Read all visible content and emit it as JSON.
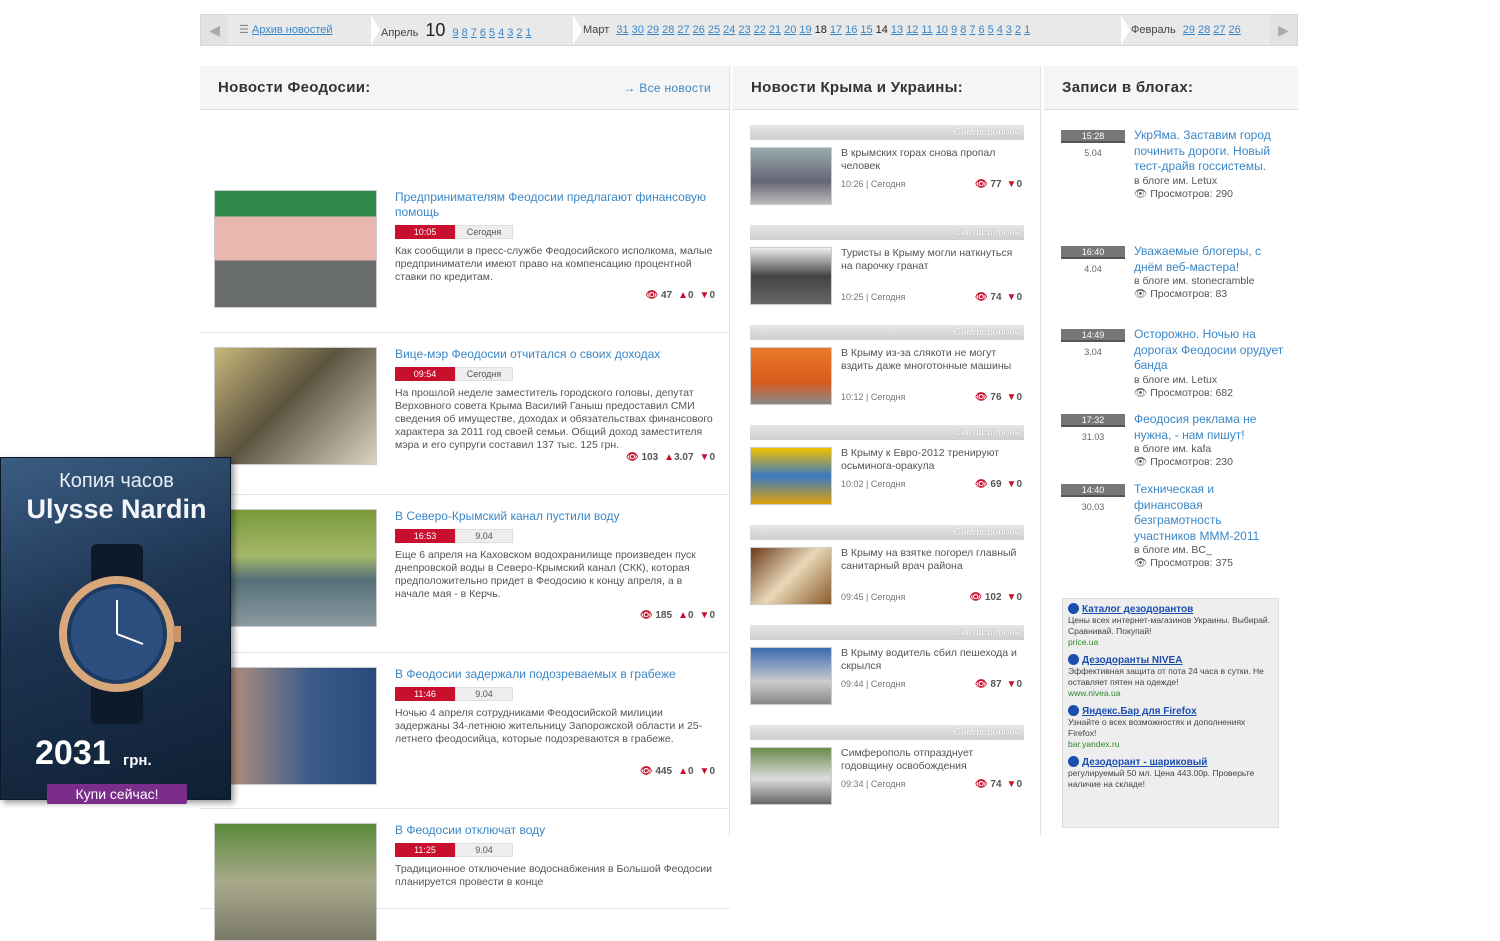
{
  "archive": {
    "link": "Архив новостей",
    "april": {
      "label": "Апрель",
      "current": "10",
      "days": [
        "9",
        "8",
        "7",
        "6",
        "5",
        "4",
        "3",
        "2",
        "1"
      ]
    },
    "march": {
      "label": "Март",
      "days": [
        "31",
        "30",
        "29",
        "28",
        "27",
        "26",
        "25",
        "24",
        "23",
        "22",
        "21",
        "20",
        "19"
      ],
      "bold1": "18",
      "days2": [
        "17",
        "16",
        "15"
      ],
      "bold2": "14",
      "days3": [
        "13",
        "12",
        "11",
        "10",
        "9",
        "8",
        "7",
        "6",
        "5",
        "4",
        "3",
        "2",
        "1"
      ]
    },
    "february": {
      "label": "Февраль",
      "days": [
        "29",
        "28",
        "27",
        "26"
      ]
    }
  },
  "col1": {
    "title": "Новости Феодосии:",
    "all_link": "→ Все новости",
    "items": [
      {
        "title": "Предпринимателям Феодосии предлагают финансовую помощь",
        "time": "10:05",
        "date": "Сегодня",
        "text": "Как сообщили в пресс-службе Феодосийского исполкома, малые предприниматели имеют право на компенсацию процентной ставки по кредитам.",
        "views": "47",
        "up": "0",
        "down": "0"
      },
      {
        "title": "Вице-мэр Феодосии отчитался о своих доходах",
        "time": "09:54",
        "date": "Сегодня",
        "text": "На прошлой неделе заместитель городского головы, депутат Верховного совета Крыма Василий Ганыш предоставил СМИ сведения об имуществе, доходах и обязательствах финансового характера за 2011 год своей семьи. Общий доход заместителя мэра и его супруги составил 137 тыс. 125 грн.",
        "views": "103",
        "up": "3.07",
        "down": "0"
      },
      {
        "title": "В Северо-Крымский канал пустили воду",
        "time": "16:53",
        "date": "9.04",
        "text": "Еще 6 апреля на Каховском водохранилище произведен пуск днепровской воды в Северо-Крымский канал (СКК), которая предположительно придет в Феодосию к концу апреля, а в начале мая - в Керчь.",
        "views": "185",
        "up": "0",
        "down": "0"
      },
      {
        "title": "В Феодосии задержали подозреваемых в грабеже",
        "time": "11:46",
        "date": "9.04",
        "text": "Ночью 4 апреля сотрудниками Феодосийской милиции задержаны 34-летнюю жительницу Запорожской области и 25-летнего феодосийца, которые подозреваются в грабеже.",
        "views": "445",
        "up": "0",
        "down": "0"
      },
      {
        "title": "В Феодосии отключат воду",
        "time": "11:25",
        "date": "9.04",
        "text": "Традиционное отключение водоснабжения в Большой Феодосии планируется провести в конце",
        "views": "",
        "up": "",
        "down": ""
      }
    ]
  },
  "col2": {
    "title": "Новости Крыма и Украины:",
    "items": [
      {
        "region": "Симферополь",
        "text": "В крымских горах снова пропал человек",
        "time": "10:26",
        "date": "Сегодня",
        "views": "77",
        "down": "0"
      },
      {
        "region": "Симферополь",
        "text": "Туристы в Крыму могли натк­нуться на парочку гранат",
        "time": "10:25",
        "date": "Сегодня",
        "views": "74",
        "down": "0"
      },
      {
        "region": "Симферополь",
        "text": "В Крыму из-за слякоти не могут вздить даже многотонные машины",
        "time": "10:12",
        "date": "Сегодня",
        "views": "76",
        "down": "0"
      },
      {
        "region": "Симферополь",
        "text": "В Крыму к Евро-2012 тренируют осьминога-оракула",
        "time": "10:02",
        "date": "Сегодня",
        "views": "69",
        "down": "0"
      },
      {
        "region": "Симферополь",
        "text": "В Крыму на взятке погорел главный санитарный врач района",
        "time": "09:45",
        "date": "Сегодня",
        "views": "102",
        "down": "0"
      },
      {
        "region": "Симферополь",
        "text": "В Крыму водитель сбил пешехода и скрылся",
        "time": "09:44",
        "date": "Сегодня",
        "views": "87",
        "down": "0"
      },
      {
        "region": "Симферополь",
        "text": "Симферополь отпразднует годовщину освобождения",
        "time": "09:34",
        "date": "Сегодня",
        "views": "74",
        "down": "0"
      }
    ]
  },
  "col3": {
    "title": "Записи в блогах:",
    "items": [
      {
        "time": "15:28",
        "date": "5.04",
        "title": "УкрЯма. Заставим город починить дороги. Новый тест-драйв госсистемы.",
        "blog": "в блоге им. Letux",
        "views": "Просмотров: 290"
      },
      {
        "time": "16:40",
        "date": "4.04",
        "title": "Уважаемые блогеры, с днём веб-мастера!",
        "blog": "в блоге им. stonecramble",
        "views": "Просмотров: 83"
      },
      {
        "time": "14:49",
        "date": "3.04",
        "title": "Осторожно. Ночью на дорогах Феодосии орудует банда",
        "blog": "в блоге им. Letux",
        "views": "Просмотров: 682"
      },
      {
        "time": "17:32",
        "date": "31.03",
        "title": "Феодосия реклама не нужна, - нам пишут!",
        "blog": "в блоге им. kafa",
        "views": "Просмотров: 230"
      },
      {
        "time": "14:40",
        "date": "30.03",
        "title": "Техническая и финансовая безграмотность участников МММ-2011",
        "blog": "в блоге им. BC_",
        "views": "Просмотров: 375"
      }
    ]
  },
  "ads": [
    {
      "title": "Каталог дезодорантов",
      "text": "Цены всех интернет-магазинов Украины. Выбирай. Сравнивай. Покупай!",
      "url": "price.ua"
    },
    {
      "title": "Дезодоранты NIVEA",
      "text": "Эффективная защита от пота 24 часа в сутки. Не оставляет пятен на одежде!",
      "url": "www.nivea.ua"
    },
    {
      "title": "Яндекс.Бар для Firefox",
      "text": "Узнайте о всех возможностях и дополнениях Firefox!",
      "url": "bar.yandex.ru"
    },
    {
      "title": "Дезодорант - шариковый",
      "text": "регулируемый 50 мл. Цена 443.00р. Проверьте наличие на складе!",
      "url": ""
    }
  ],
  "banner": {
    "line1": "Копия часов",
    "line2": "Ulysse Nardin",
    "price": "2031",
    "currency": "грн.",
    "cta": "Купи сейчас!"
  }
}
